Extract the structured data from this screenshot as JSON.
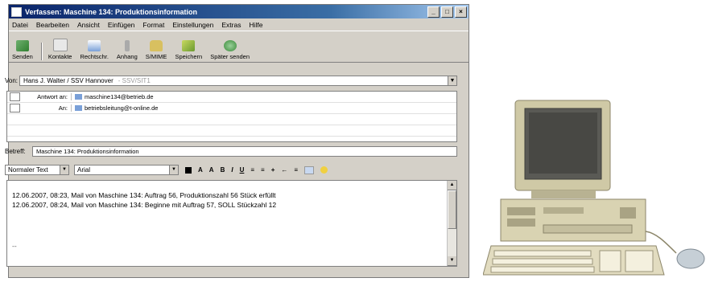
{
  "window": {
    "title": "Verfassen: Maschine 134: Produktionsinformation",
    "controls": [
      "_",
      "□",
      "×"
    ]
  },
  "menu": [
    "Datei",
    "Bearbeiten",
    "Ansicht",
    "Einfügen",
    "Format",
    "Einstellungen",
    "Extras",
    "Hilfe"
  ],
  "toolbar": [
    {
      "label": "Senden",
      "icon": "send-icon"
    },
    {
      "label": "Kontakte",
      "icon": "contacts-icon"
    },
    {
      "label": "Rechtschr.",
      "icon": "spellcheck-icon"
    },
    {
      "label": "Anhang",
      "icon": "attachment-icon"
    },
    {
      "label": "S/MIME",
      "icon": "lock-icon"
    },
    {
      "label": "Speichern",
      "icon": "save-icon"
    },
    {
      "label": "Später senden",
      "icon": "send-later-icon"
    }
  ],
  "from": {
    "label": "Von:",
    "value": "Hans J. Walter / SSV Hannover",
    "suffix": "- SSV/SIT1"
  },
  "recipients": [
    {
      "type": "Antwort an:",
      "address": "maschine134@betrieb.de"
    },
    {
      "type": "An:",
      "address": "betriebsleitung@t-online.de"
    }
  ],
  "subject": {
    "label": "Betreff:",
    "value": "Maschine 134: Produktionsinformation"
  },
  "format": {
    "style": "Normaler Text",
    "font": "Arial",
    "buttons": [
      "A",
      "A",
      "B",
      "I",
      "U",
      "≡",
      "≡",
      "+",
      "←",
      "≡"
    ]
  },
  "message": [
    "12.06.2007, 08:23, Mail von Maschine 134: Auftrag 56, Produktionszahl 56 Stück erfüllt",
    "12.06.2007, 08:24, Mail von Maschine 134: Beginne mit Auftrag 57, SOLL Stückzahl 12",
    "--"
  ],
  "colors": {
    "title_start": "#0a246a",
    "title_end": "#a6caf0",
    "chrome": "#d4d0c8"
  }
}
